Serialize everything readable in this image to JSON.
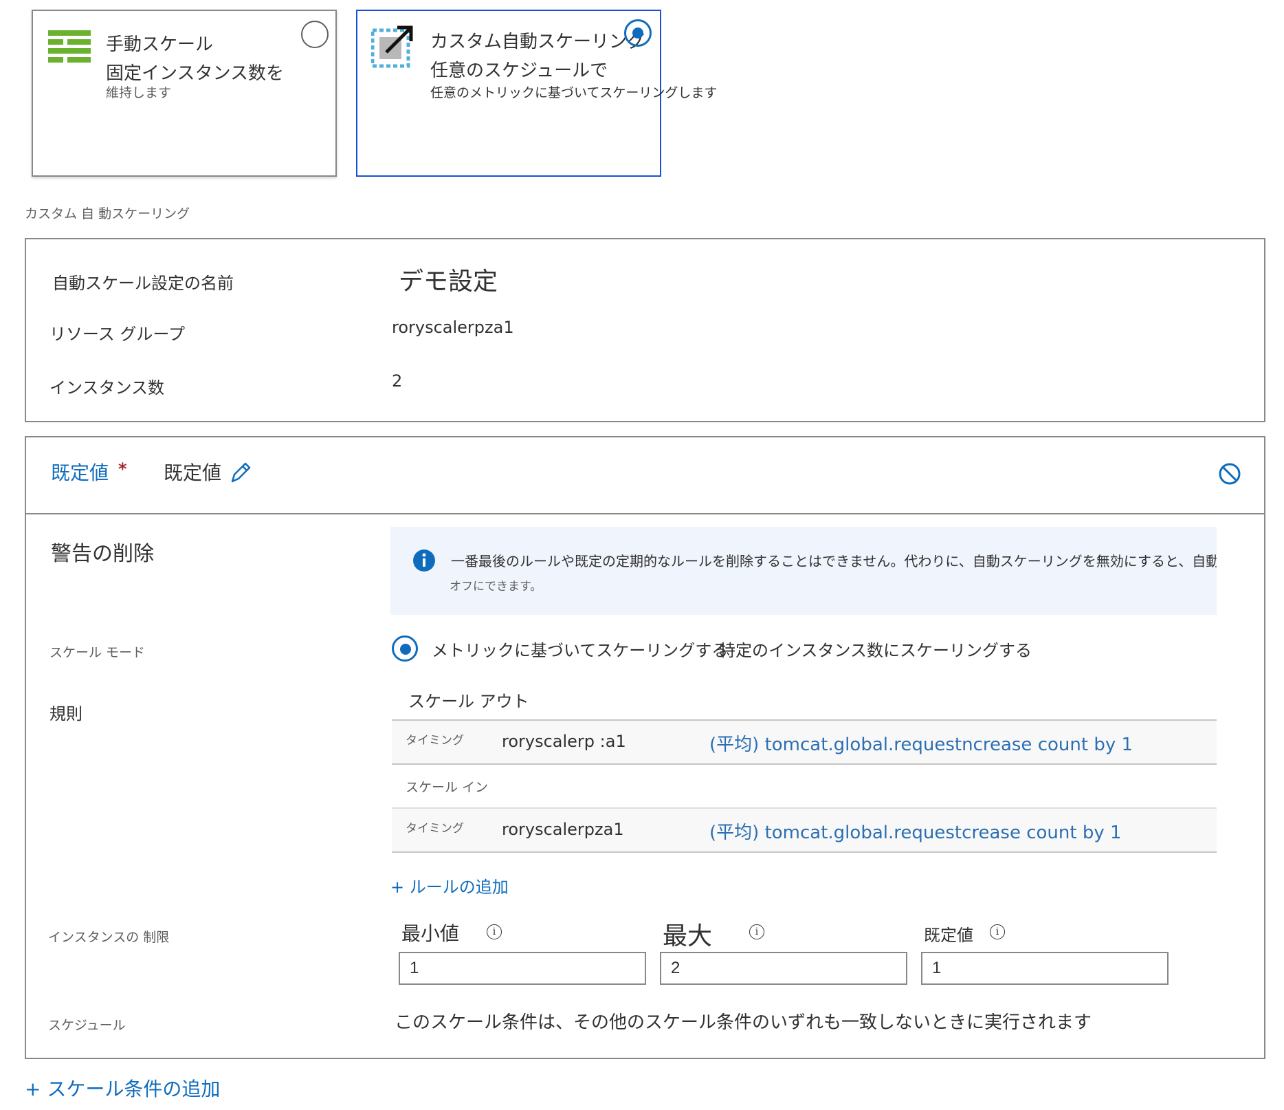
{
  "options": {
    "manual": {
      "title": "手動スケール",
      "line1": "固定インスタンス数を",
      "line2": "維持します"
    },
    "custom": {
      "title": "カスタム自動スケーリング",
      "line1": "任意のスケジュールで",
      "line2": "任意のメトリックに基づいてスケーリングします"
    }
  },
  "section_caption": "カスタム 自 動スケーリング",
  "settings": {
    "name_label": "自動スケール設定の名前",
    "name_value": "デモ設定",
    "rg_label": "リソース グループ",
    "rg_value": "roryscalerpza1",
    "instances_label": "インスタンス数",
    "instances_value": "2"
  },
  "condition": {
    "tab_label": "既定値",
    "required_mark": "*",
    "name": "既定値",
    "delete_warning_title": "警告の削除",
    "info_text": "一番最後のルールや既定の定期的なルールを削除することはできません。代わりに、自動スケーリングを無効にすると、自動スケーリ",
    "info_text_2": "オフにできます。",
    "scale_mode_label": "スケール モード",
    "scale_mode_option1": "メトリックに基づいてスケーリングする",
    "scale_mode_option2": "特定のインスタンス数にスケーリングする",
    "rules_label": "規則",
    "scale_out_header": "スケール アウト",
    "scale_in_header": "スケール イン",
    "rules": [
      {
        "timing": "タイミング",
        "resource": "roryscalerp :a1",
        "agg": "(平均)",
        "metric": "tomcat.global.requestncrease count by 1"
      },
      {
        "timing": "タイミング",
        "resource": "roryscalerpza1",
        "agg": "(平均)",
        "metric": "tomcat.global.requestcrease count by 1"
      }
    ],
    "add_rule": "+ ルールの追加",
    "instance_limits_label": "インスタンスの 制限",
    "min_label": "最小値",
    "max_label": "最大",
    "default_label": "既定値",
    "min_value": "1",
    "max_value": "2",
    "default_value": "1",
    "schedule_label": "スケジュール",
    "schedule_text": "このスケール条件は、その他のスケール条件のいずれも一致しないときに実行されます"
  },
  "add_condition": "+ スケール条件の追加",
  "colors": {
    "accent": "#0f6cbd",
    "selected_border": "#1a4fd8",
    "info_bg": "#eff4fd",
    "manual_icon_green": "#6bb130",
    "custom_icon_blue": "#50b0d8"
  },
  "icons": [
    "manual-scale-icon",
    "custom-autoscale-icon",
    "pencil-icon",
    "disable-icon",
    "info-icon",
    "plus-icon"
  ]
}
